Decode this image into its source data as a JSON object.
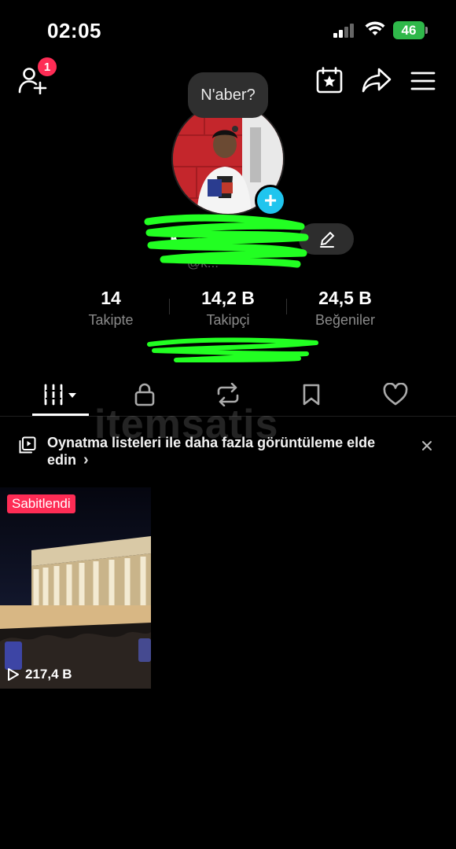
{
  "status_bar": {
    "time": "02:05",
    "battery": "46",
    "battery_color": "#2fb84a"
  },
  "header": {
    "notification_count": "1",
    "badge_color": "#fe2c55"
  },
  "profile": {
    "note": "N'aber?",
    "display_name": "k...",
    "username": "@k...",
    "stats": [
      {
        "value": "14",
        "label": "Takipte"
      },
      {
        "value": "14,2 B",
        "label": "Takipçi"
      },
      {
        "value": "24,5 B",
        "label": "Beğeniler"
      }
    ]
  },
  "tabs": [
    {
      "icon": "videos-grid-icon"
    },
    {
      "icon": "lock-icon"
    },
    {
      "icon": "repost-icon"
    },
    {
      "icon": "bookmark-icon"
    },
    {
      "icon": "heart-icon"
    }
  ],
  "banner": {
    "text": "Oynatma listeleri ile daha fazla görüntüleme elde edin",
    "chevron": "›"
  },
  "watermark": "itemsatis",
  "videos": [
    {
      "pinned_label": "Sabitlendi",
      "views": "217,4 B"
    }
  ],
  "colors": {
    "accent": "#fe2c55",
    "avatar_plus": "#20c5ee",
    "scribble": "#22ff22"
  }
}
